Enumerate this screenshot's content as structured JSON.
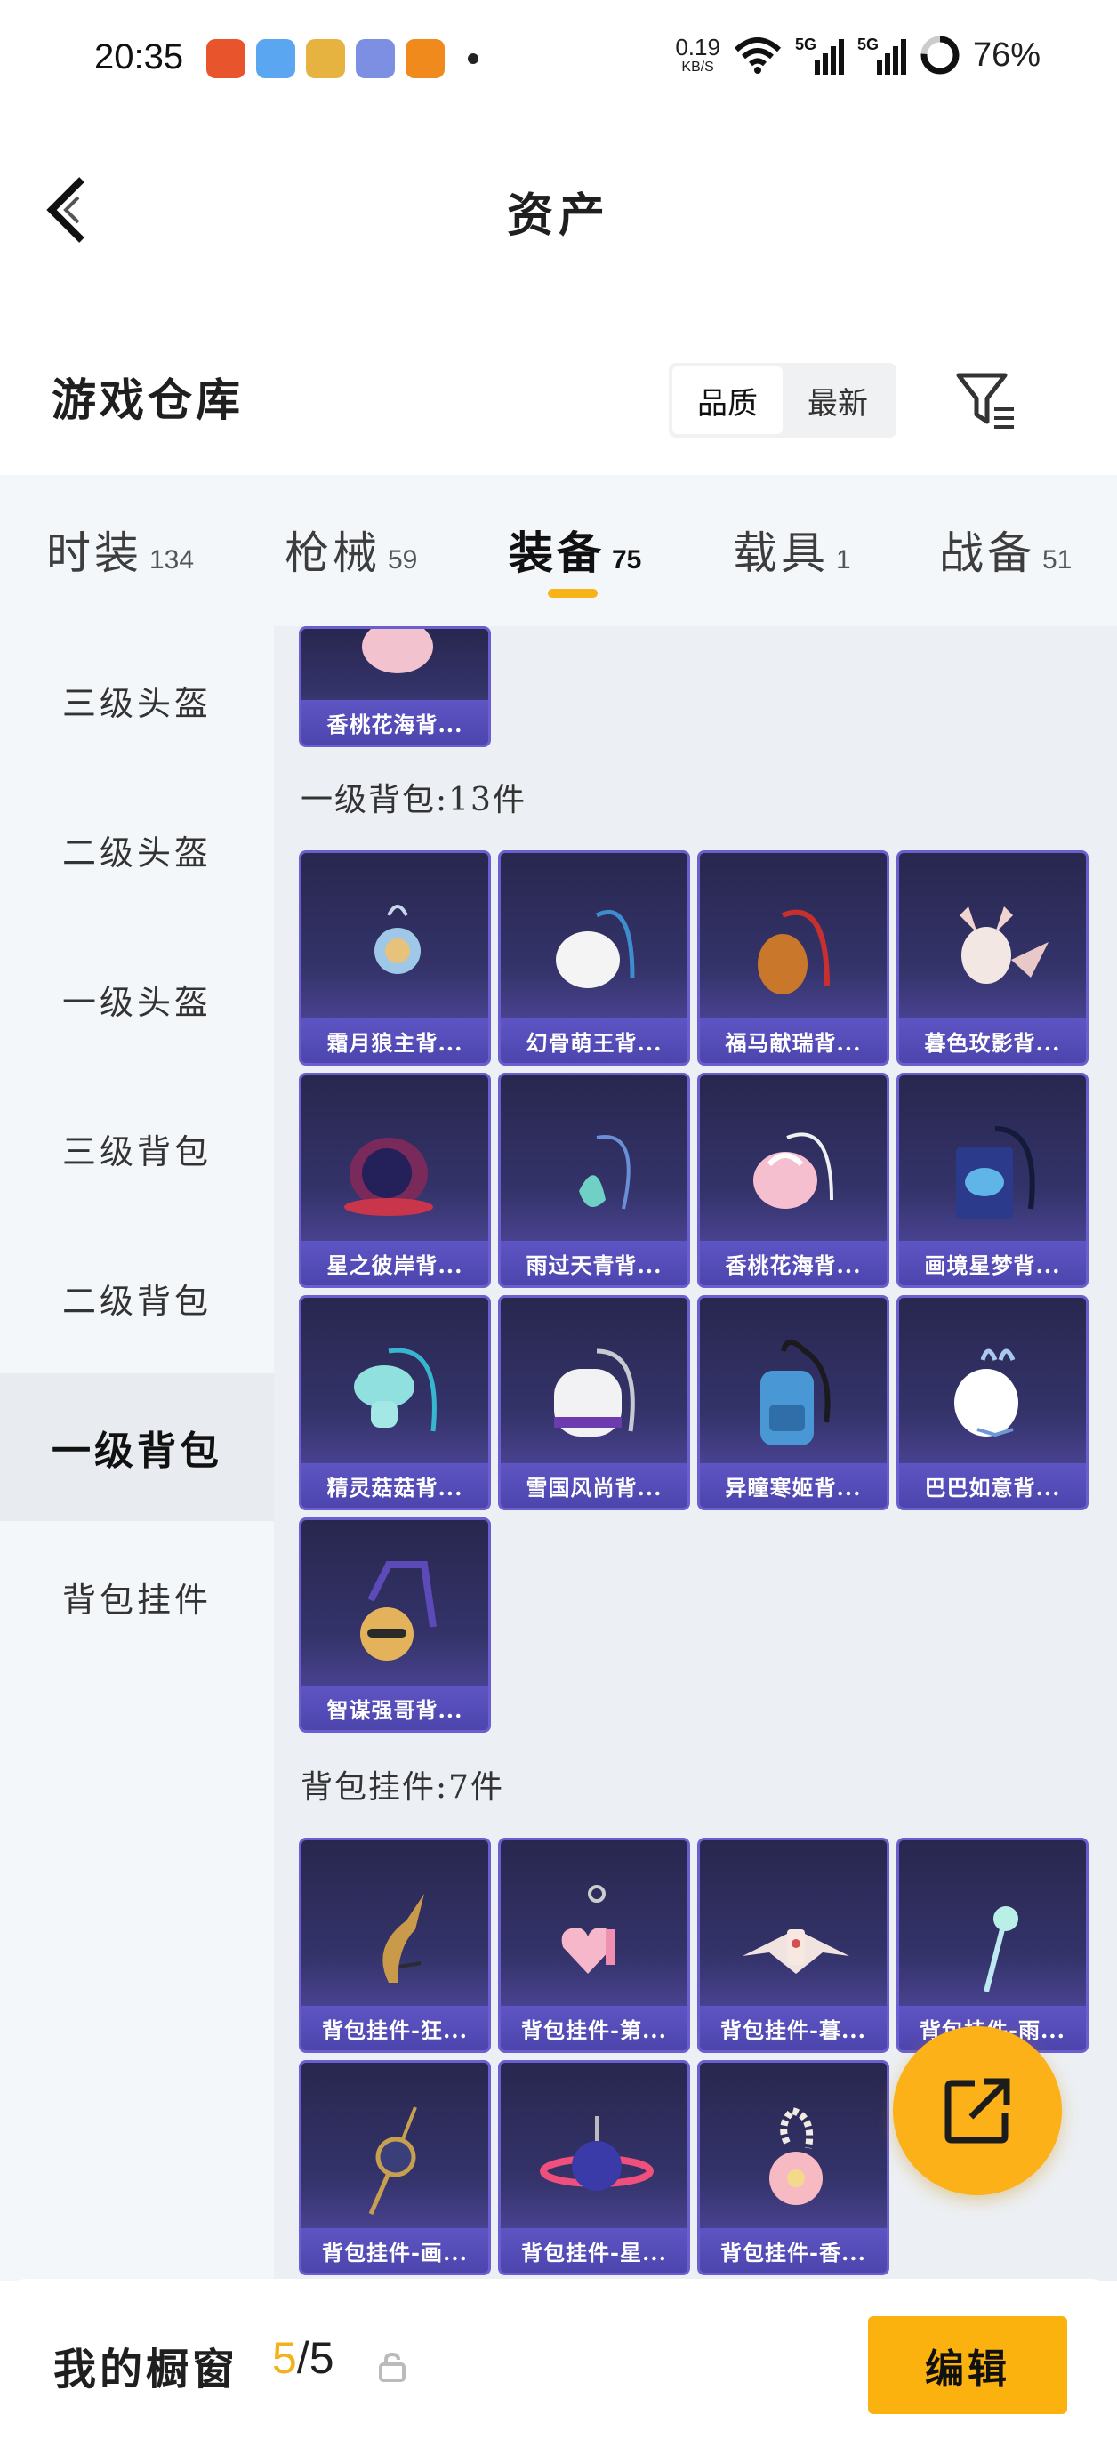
{
  "status_bar": {
    "time": "20:35",
    "net_speed_value": "0.19",
    "net_speed_unit": "KB/S",
    "signal_1": "5G",
    "signal_2": "5G",
    "battery": "76%",
    "icons": [
      "wifi-icon",
      "signal-icon",
      "battery-ring-icon"
    ]
  },
  "nav": {
    "title": "资产",
    "back_icon": "back-chevron-icon"
  },
  "header": {
    "title": "游戏仓库",
    "sort_options": [
      "品质",
      "最新"
    ],
    "sort_active": "品质",
    "filter_icon": "filter-icon"
  },
  "tabs": [
    {
      "name": "时装",
      "count": "134"
    },
    {
      "name": "枪械",
      "count": "59"
    },
    {
      "name": "装备",
      "count": "75",
      "active": true
    },
    {
      "name": "载具",
      "count": "1"
    },
    {
      "name": "战备",
      "count": "51"
    }
  ],
  "sidebar": {
    "items": [
      "三级头盔",
      "二级头盔",
      "一级头盔",
      "三级背包",
      "二级背包",
      "一级背包",
      "背包挂件"
    ],
    "active": "一级背包"
  },
  "groups": {
    "prev_partial_item": "香桃花海背...",
    "level1": {
      "label": "一级背包:13件",
      "items": [
        "霜月狼主背...",
        "幻骨萌王背...",
        "福马献瑞背...",
        "暮色玫影背...",
        "星之彼岸背...",
        "雨过天青背...",
        "香桃花海背...",
        "画境星梦背...",
        "精灵菇菇背...",
        "雪国风尚背...",
        "异瞳寒姬背...",
        "巴巴如意背...",
        "智谋强哥背..."
      ]
    },
    "charms": {
      "label": "背包挂件:7件",
      "items": [
        "背包挂件-狂...",
        "背包挂件-第...",
        "背包挂件-暮...",
        "背包挂件-雨...",
        "背包挂件-画...",
        "背包挂件-星...",
        "背包挂件-香..."
      ]
    }
  },
  "fab": {
    "icon": "share-external-icon"
  },
  "bottom": {
    "title": "我的橱窗",
    "count_current": "5",
    "count_total": "/5",
    "lock_icon": "lock-icon",
    "edit_label": "编辑"
  },
  "colors": {
    "accent": "#fbb20f",
    "card_bg": "#2e2d5e",
    "card_caption": "#5b52c0",
    "tab_indicator": "#f7b318"
  }
}
